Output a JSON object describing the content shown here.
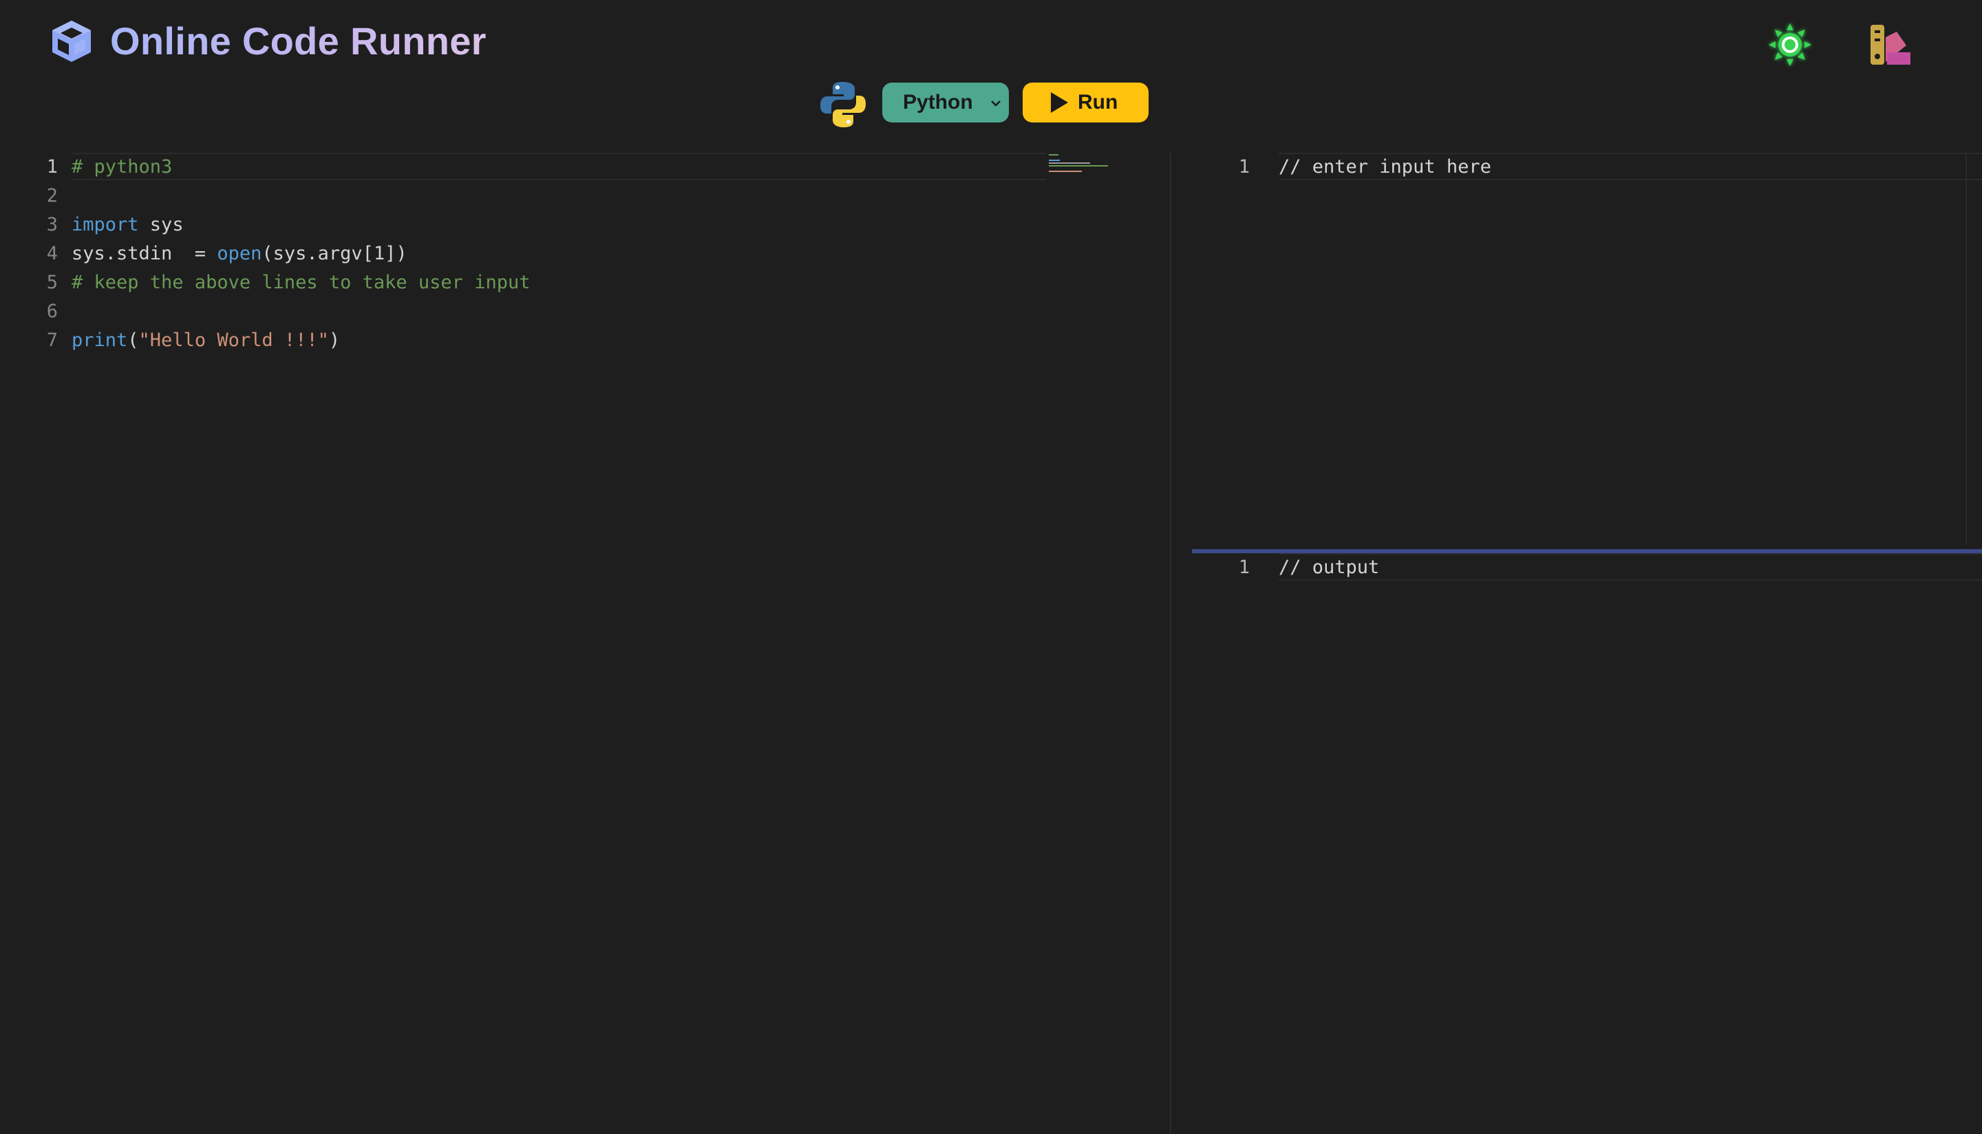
{
  "header": {
    "title": "Online Code Runner",
    "logo_icon": "cube-icon",
    "theme_toggle_icon": "sun-icon",
    "palette_icon": "color-palette-icon"
  },
  "toolbar": {
    "language_icon": "python-logo-icon",
    "language_selected": "Python",
    "run_label": "Run",
    "run_icon": "play-icon"
  },
  "colors": {
    "background": "#1e1e1e",
    "language_select_bg": "#4ea78f",
    "run_button_bg": "#ffc20e",
    "title_gradient_start": "#a8b6f7",
    "title_gradient_end": "#d9c3ea",
    "split_handle": "#3c4a8a",
    "sun_glow": "#39d353"
  },
  "code_editor": {
    "line_numbers": [
      "1",
      "2",
      "3",
      "4",
      "5",
      "6",
      "7"
    ],
    "lines": [
      [
        {
          "type": "comment",
          "text": "# python3"
        }
      ],
      [],
      [
        {
          "type": "keyword",
          "text": "import"
        },
        {
          "type": "plain",
          "text": " sys"
        }
      ],
      [
        {
          "type": "plain",
          "text": "sys.stdin  = "
        },
        {
          "type": "keyword",
          "text": "open"
        },
        {
          "type": "plain",
          "text": "(sys.argv[1])"
        }
      ],
      [
        {
          "type": "comment",
          "text": "# keep the above lines to take user input"
        }
      ],
      [],
      [
        {
          "type": "keyword",
          "text": "print"
        },
        {
          "type": "plain",
          "text": "("
        },
        {
          "type": "string",
          "text": "\"Hello World !!!\""
        },
        {
          "type": "plain",
          "text": ")"
        }
      ]
    ]
  },
  "input_editor": {
    "line_numbers": [
      "1"
    ],
    "lines": [
      "// enter input here"
    ]
  },
  "output_editor": {
    "line_numbers": [
      "1"
    ],
    "lines": [
      "// output"
    ]
  }
}
